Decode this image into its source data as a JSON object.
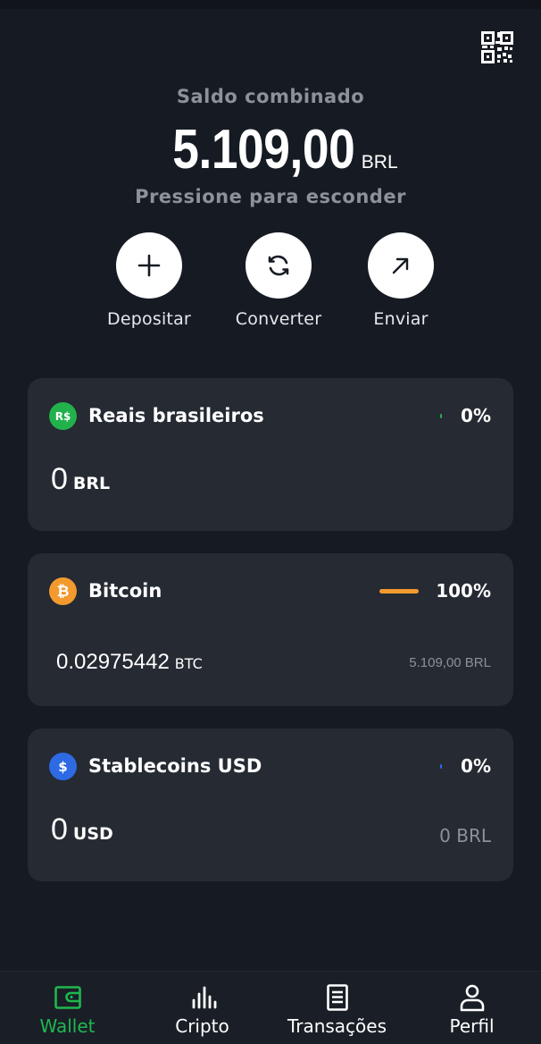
{
  "colors": {
    "background": "#161b23",
    "card": "#252a33",
    "muted_text": "#8d9198",
    "active_nav": "#1fb74f",
    "brl_coin": "#21b24b",
    "btc_coin": "#f29a2e",
    "usd_coin": "#2d6ae3",
    "btc_bar": "#f29a2e"
  },
  "header": {
    "qr_icon": "qr-code-icon"
  },
  "balance": {
    "label": "Saldo combinado",
    "value": "5.109,00",
    "currency": "BRL",
    "hide_hint": "Pressione para esconder"
  },
  "actions": [
    {
      "label": "Depositar",
      "icon": "plus-icon"
    },
    {
      "label": "Converter",
      "icon": "convert-icon"
    },
    {
      "label": "Enviar",
      "icon": "send-arrow-icon"
    }
  ],
  "assets": [
    {
      "coin_symbol": "R$",
      "name": "Reais brasileiros",
      "percent": "0%",
      "share": 0,
      "amount": "0",
      "unit": "BRL",
      "fiat_value": ""
    },
    {
      "coin_symbol": "₿",
      "name": "Bitcoin",
      "percent": "100%",
      "share": 1,
      "amount": "0.02975442",
      "unit": "BTC",
      "fiat_value": "5.109,00 BRL"
    },
    {
      "coin_symbol": "$",
      "name": "Stablecoins USD",
      "percent": "0%",
      "share": 0,
      "amount": "0",
      "unit": "USD",
      "fiat_value": "0 BRL"
    }
  ],
  "nav": [
    {
      "label": "Wallet",
      "icon": "wallet-icon",
      "active": true
    },
    {
      "label": "Cripto",
      "icon": "chart-bars-icon",
      "active": false
    },
    {
      "label": "Transações",
      "icon": "document-icon",
      "active": false
    },
    {
      "label": "Perfil",
      "icon": "person-icon",
      "active": false
    }
  ]
}
